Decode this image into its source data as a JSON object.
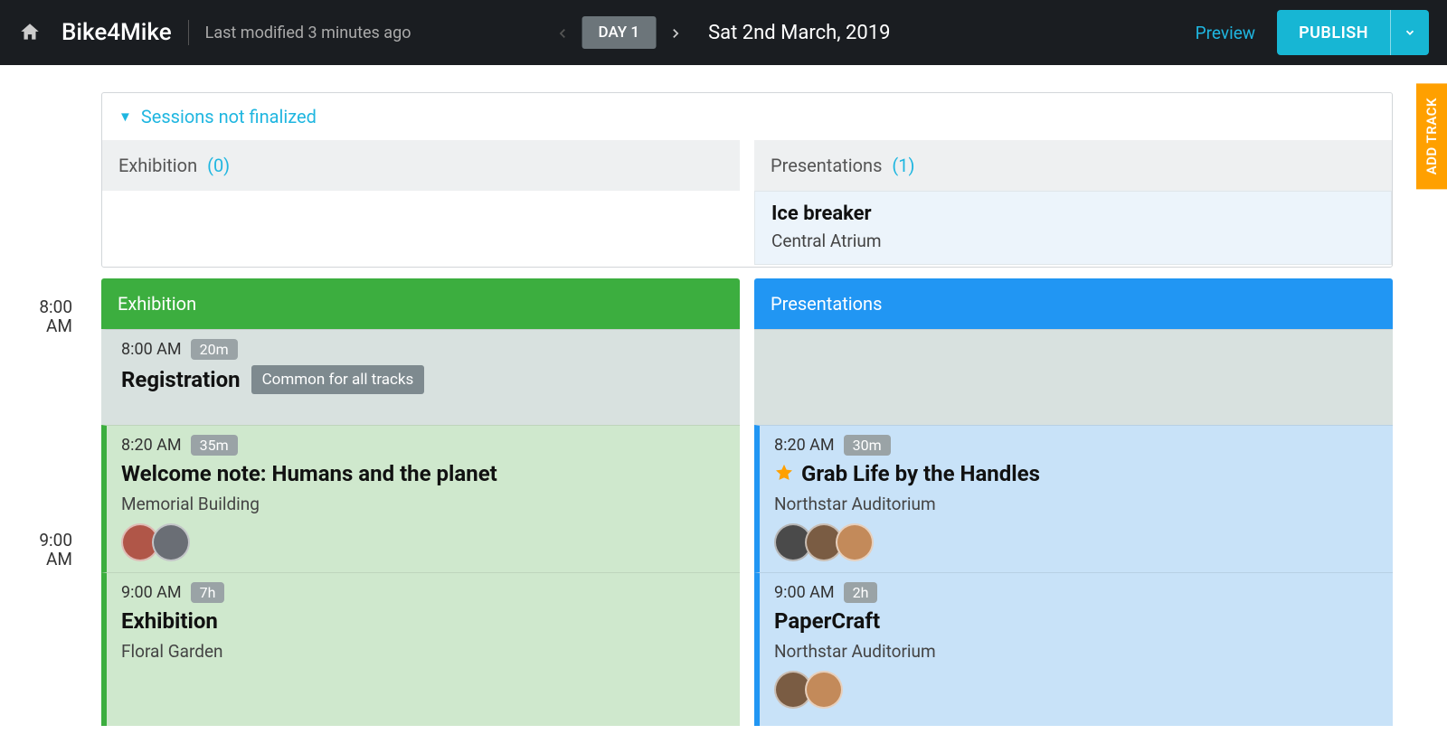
{
  "header": {
    "event_name": "Bike4Mike",
    "last_modified": "Last modified 3 minutes ago",
    "day_label": "DAY 1",
    "date_text": "Sat 2nd March, 2019",
    "preview": "Preview",
    "publish": "PUBLISH"
  },
  "side": {
    "add_track": "ADD TRACK"
  },
  "not_finalized": {
    "header": "Sessions not finalized",
    "cols": [
      {
        "name": "Exhibition",
        "count": "(0)"
      },
      {
        "name": "Presentations",
        "count": "(1)"
      }
    ],
    "card": {
      "title": "Ice breaker",
      "location": "Central Atrium"
    }
  },
  "tracks": {
    "left": "Exhibition",
    "right": "Presentations"
  },
  "timeslots": {
    "t8": {
      "time": "8:00",
      "ampm": "AM"
    },
    "t9": {
      "time": "9:00",
      "ampm": "AM"
    }
  },
  "sessions": {
    "registration": {
      "time": "8:00 AM",
      "duration": "20m",
      "title": "Registration",
      "tag": "Common for all tracks"
    },
    "welcome": {
      "time": "8:20 AM",
      "duration": "35m",
      "title": "Welcome note: Humans and the planet",
      "location": "Memorial Building"
    },
    "exhibition": {
      "time": "9:00 AM",
      "duration": "7h",
      "title": "Exhibition",
      "location": "Floral Garden"
    },
    "grab": {
      "time": "8:20 AM",
      "duration": "30m",
      "title": "Grab Life by the Handles",
      "location": "Northstar Auditorium"
    },
    "papercraft": {
      "time": "9:00 AM",
      "duration": "2h",
      "title": "PaperCraft",
      "location": "Northstar Auditorium"
    }
  }
}
